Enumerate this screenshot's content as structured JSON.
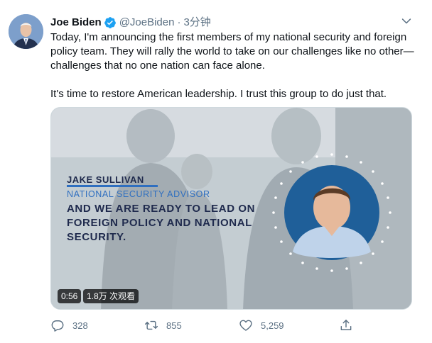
{
  "tweet": {
    "author_name": "Joe Biden",
    "handle": "@JoeBiden",
    "separator": "·",
    "time": "3分钟",
    "text_p1": "Today, I'm announcing the first members of my national security and foreign policy team. They will rally the world to take on our challenges like no other—challenges that no one nation can face alone.",
    "text_p2": "It's time to restore American leadership. I trust this group to do just that."
  },
  "media": {
    "overlay_name": "JAKE SULLIVAN",
    "overlay_role": "NATIONAL SECURITY ADVISOR",
    "overlay_quote": "AND WE ARE READY TO LEAD ON FOREIGN POLICY AND NATIONAL SECURITY.",
    "duration": "0:56",
    "views": "1.8万 次观看"
  },
  "actions": {
    "replies": "328",
    "retweets": "855",
    "likes": "5,259"
  },
  "colors": {
    "verified": "#1da1f2",
    "muted": "#5b7083",
    "navy": "#1f2a4d",
    "accent_blue": "#2f6fc0"
  },
  "icons": {
    "verified": "verified-badge-icon",
    "caret": "chevron-down-icon",
    "reply": "reply-icon",
    "retweet": "retweet-icon",
    "like": "heart-icon",
    "share": "share-icon"
  }
}
